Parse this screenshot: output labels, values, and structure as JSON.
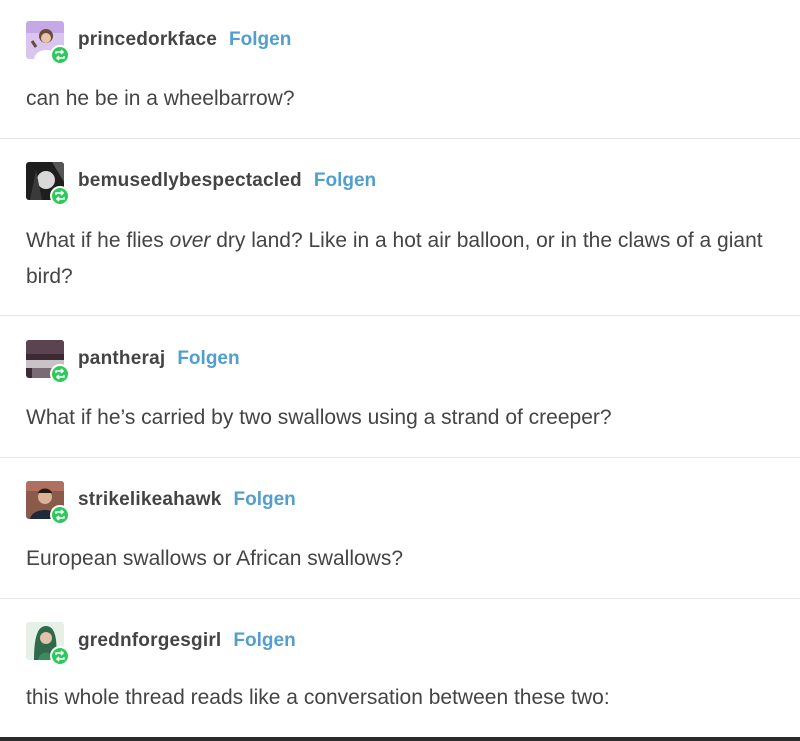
{
  "thread": {
    "posts": [
      {
        "username": "princedorkface",
        "follow_label": "Folgen",
        "text": "can he be in a wheelbarrow?",
        "avatar_icon": "user-avatar-purple",
        "badge_icon": "reblog-icon"
      },
      {
        "username": "bemusedlybespectacled",
        "follow_label": "Folgen",
        "text_before": "What if he flies ",
        "text_emphasis": "over",
        "text_after": " dry land? Like in a hot air balloon, or in the claws of a giant bird?",
        "avatar_icon": "user-avatar-dark",
        "badge_icon": "reblog-icon"
      },
      {
        "username": "pantheraj",
        "follow_label": "Folgen",
        "text": "What if he’s carried by two swallows using a strand of creeper?",
        "avatar_icon": "user-avatar-photo",
        "badge_icon": "reblog-icon"
      },
      {
        "username": "strikelikeahawk",
        "follow_label": "Folgen",
        "text": "European swallows or African swallows?",
        "avatar_icon": "user-avatar-person",
        "badge_icon": "reblog-icon"
      },
      {
        "username": "grednforgesgirl",
        "follow_label": "Folgen",
        "text": "this whole thread reads like a conversation between these two:",
        "avatar_icon": "user-avatar-green",
        "badge_icon": "reblog-icon"
      }
    ]
  },
  "colors": {
    "text": "#444444",
    "follow": "#529ecc",
    "reblog_badge": "#2ec95c",
    "divider": "#e6e6e6"
  }
}
